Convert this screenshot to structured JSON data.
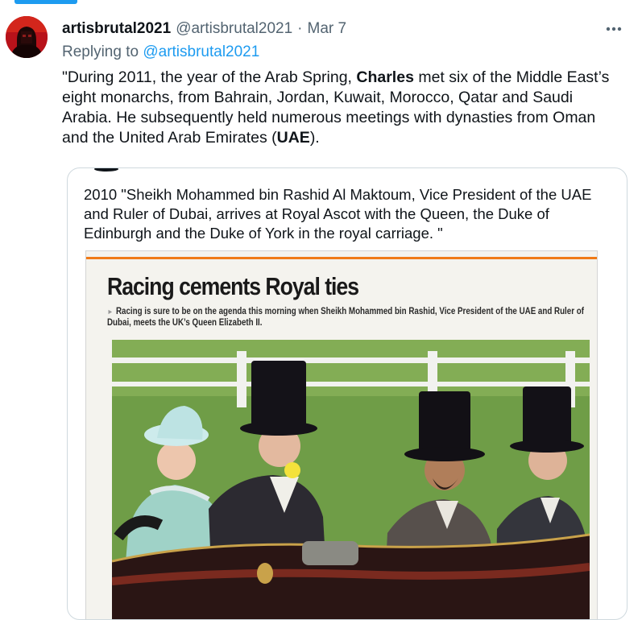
{
  "tweet": {
    "display_name": "artisbrutal2021",
    "handle": "@artisbrutal2021",
    "separator": "·",
    "date": "Mar 7",
    "replying_prefix": "Replying to",
    "replying_handle": "@artisbrutal2021",
    "text": {
      "part1": "\"During 2011, the year of the Arab Spring, ",
      "bold1": "Charles",
      "part2": " met six of the Middle East’s eight monarchs, from Bahrain, Jordan, Kuwait, Morocco, Qatar and Saudi Arabia. He subsequently held numerous meetings with dynasties from Oman and the United Arab Emirates (",
      "bold2": "UAE",
      "part3": ")."
    },
    "more_icon": "more-horizontal-icon"
  },
  "quote": {
    "text": "2010 \"Sheikh Mohammed bin Rashid Al Maktoum, Vice President of the UAE and Ruler of Dubai, arrives at Royal Ascot with the Queen, the Duke of Edinburgh and the Duke of York in the royal carriage. \""
  },
  "news_clip": {
    "headline": "Racing cements Royal ties",
    "standfirst": "Racing is sure to be on the agenda this morning when Sheikh Mohammed bin Rashid, Vice President of the UAE and Ruler of Dubai, meets the UK’s Queen Elizabeth II."
  },
  "colors": {
    "accent": "#1d9bf0",
    "text": "#0f1419",
    "muted": "#536471",
    "border": "#cfd9de",
    "rule": "#f07a16"
  }
}
